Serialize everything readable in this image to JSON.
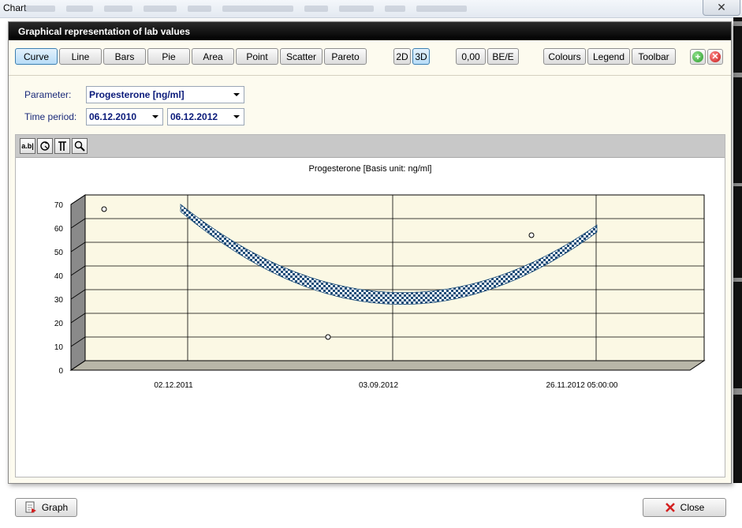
{
  "window": {
    "title": "Chart"
  },
  "dialog": {
    "title": "Graphical representation of lab values"
  },
  "toolbar": {
    "chart_types": [
      "Curve",
      "Line",
      "Bars",
      "Pie",
      "Area",
      "Point",
      "Scatter",
      "Pareto"
    ],
    "active_chart_type": "Curve",
    "dimensions": [
      "2D",
      "3D"
    ],
    "active_dimension": "3D",
    "decimals_label": "0,00",
    "be_label": "BE/E",
    "colours_label": "Colours",
    "legend_label": "Legend",
    "toolbar_label": "Toolbar",
    "icons": {
      "add": "add-icon",
      "cancel": "cancel-icon"
    }
  },
  "filter": {
    "parameter_label": "Parameter:",
    "parameter_value": "Progesterone [ng/ml]",
    "period_label": "Time period:",
    "period_from": "06.12.2010",
    "period_to": "06.12.2012"
  },
  "chart_toolbar": {
    "icons": [
      "text-label-icon",
      "rotate-icon",
      "axis-icon",
      "zoom-icon"
    ],
    "text_icon_label": "a.b|"
  },
  "chart_data": {
    "type": "area",
    "title": "Progesterone   [Basis unit: ng/ml]",
    "view": "3D",
    "ylim": [
      0,
      70
    ],
    "yticks": [
      "0",
      "10",
      "20",
      "30",
      "40",
      "50",
      "60",
      "70"
    ],
    "xticks": [
      "02.12.2011",
      "03.09.2012",
      "26.11.2012 05:00:00"
    ],
    "points": [
      {
        "x": "02.12.2011",
        "y": 66
      },
      {
        "x": "03.09.2012",
        "y": 12
      },
      {
        "x": "26.11.2012 05:00:00",
        "y": 55
      }
    ],
    "curve": [
      {
        "x": "02.12.2011",
        "y": 67
      },
      {
        "x": "03.09.2012",
        "y": 30
      },
      {
        "x": "26.11.2012 05:00:00",
        "y": 56
      }
    ],
    "grid": true,
    "fill_pattern": "blue-white checkerboard"
  },
  "footer": {
    "graph_label": "Graph",
    "close_label": "Close",
    "icons": {
      "graph": "graph-doc-icon",
      "close": "close-x-icon"
    }
  },
  "colors": {
    "accent": "#3c7fb1",
    "dialog_bg": "#fdfbef",
    "header_bg": "#000000",
    "curve_blue": "#1f4e79"
  }
}
